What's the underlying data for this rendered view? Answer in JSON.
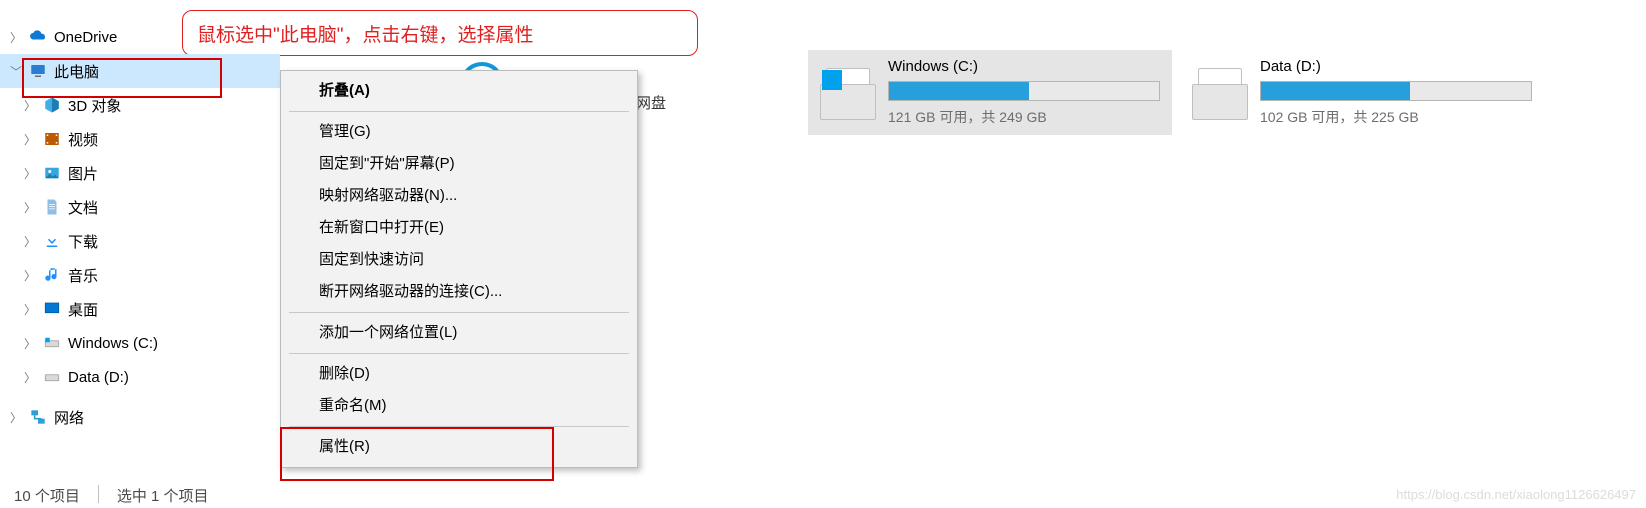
{
  "callout": {
    "text": "鼠标选中\"此电脑\"，点击右键，选择属性"
  },
  "tree": {
    "onedrive": "OneDrive",
    "this_pc": "此电脑",
    "obj3d": "3D 对象",
    "video": "视频",
    "pic": "图片",
    "doc": "文档",
    "down": "下载",
    "music": "音乐",
    "desk": "桌面",
    "drive_c": "Windows (C:)",
    "drive_d": "Data (D:)",
    "network": "网络"
  },
  "baidu": {
    "label": "百度网盘",
    "behind": "网盘"
  },
  "ctx": {
    "collapse": "折叠(A)",
    "manage": "管理(G)",
    "pin_start": "固定到\"开始\"屏幕(P)",
    "map_net": "映射网络驱动器(N)...",
    "open_new": "在新窗口中打开(E)",
    "pin_quick": "固定到快速访问",
    "disconnect": "断开网络驱动器的连接(C)...",
    "add_netloc": "添加一个网络位置(L)",
    "delete": "删除(D)",
    "rename": "重命名(M)",
    "prop": "属性(R)"
  },
  "drives": {
    "c": {
      "title": "Windows (C:)",
      "sub": "121 GB 可用，共 249 GB",
      "fill_pct": 52
    },
    "d": {
      "title": "Data (D:)",
      "sub": "102 GB 可用，共 225 GB",
      "fill_pct": 55
    }
  },
  "status": {
    "count": "10 个项目",
    "sel": "选中 1 个项目"
  },
  "watermark": "https://blog.csdn.net/xiaolong1126626497"
}
